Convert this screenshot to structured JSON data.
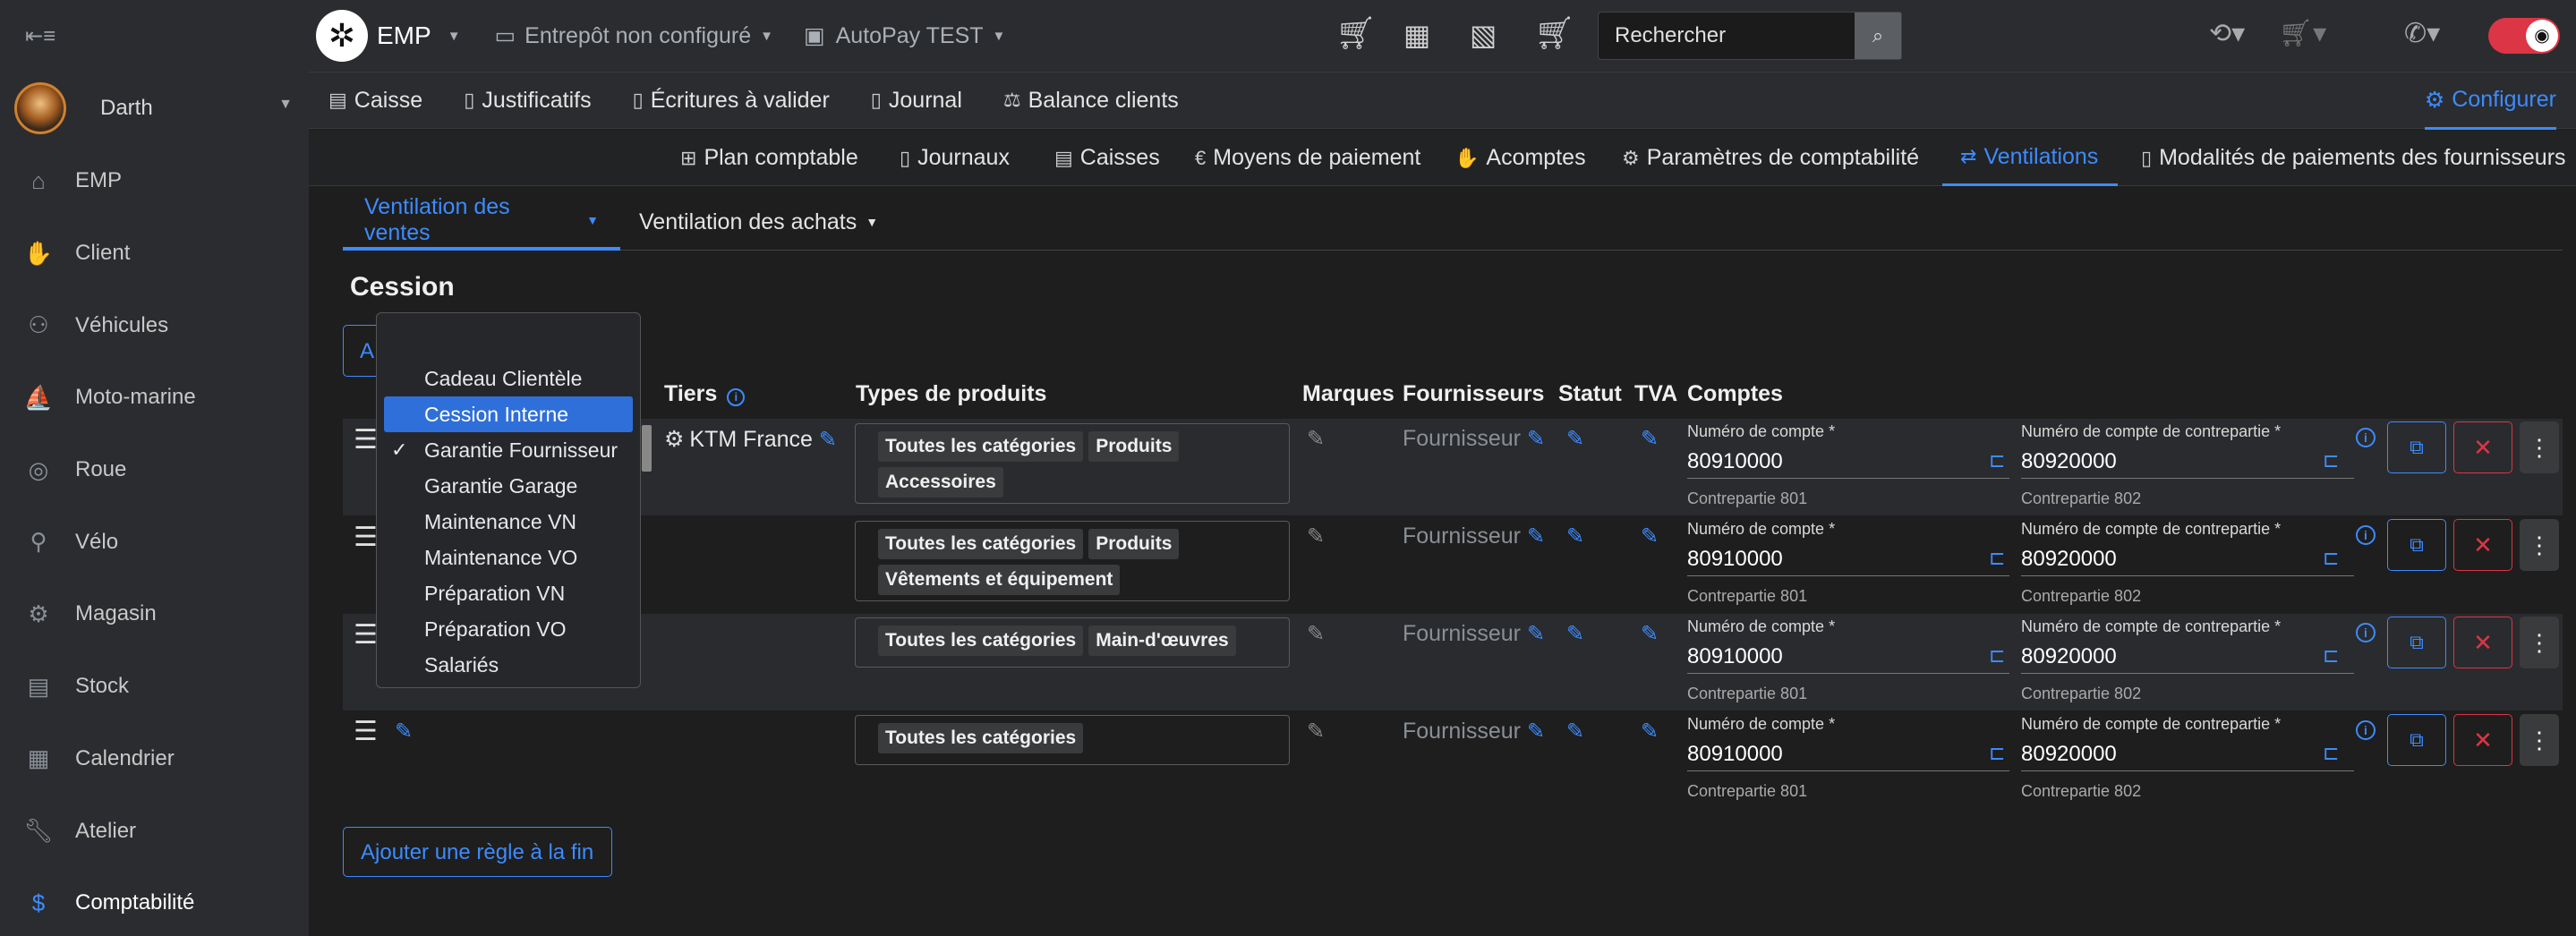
{
  "sidebar": {
    "user": "Darth",
    "items": [
      {
        "label": "EMP",
        "icon": "house-icon"
      },
      {
        "label": "Client",
        "icon": "handshake-icon"
      },
      {
        "label": "Véhicules",
        "icon": "motorcycle-icon"
      },
      {
        "label": "Moto-marine",
        "icon": "jetski-icon"
      },
      {
        "label": "Roue",
        "icon": "wheel-icon"
      },
      {
        "label": "Vélo",
        "icon": "bicycle-icon"
      },
      {
        "label": "Magasin",
        "icon": "store-icon"
      },
      {
        "label": "Stock",
        "icon": "warehouse-icon"
      },
      {
        "label": "Calendrier",
        "icon": "calendar-icon"
      },
      {
        "label": "Atelier",
        "icon": "wrench-icon"
      },
      {
        "label": "Comptabilité",
        "icon": "dollar-icon"
      }
    ]
  },
  "topbar": {
    "brand": "EMP",
    "warehouse": "Entrepôt non configuré",
    "payment": "AutoPay TEST",
    "search_text": "Rechercher"
  },
  "nav1": {
    "items": [
      "Caisse",
      "Justificatifs",
      "Écritures à valider",
      "Journal",
      "Balance clients"
    ],
    "configure": "Configurer"
  },
  "nav2": {
    "items": [
      "Plan comptable",
      "Journaux",
      "Caisses",
      "Moyens de paiement",
      "Acomptes",
      "Paramètres de comptabilité",
      "Ventilations",
      "Modalités de paiements des fournisseurs"
    ]
  },
  "tabs": {
    "sales": "Ventilation des ventes",
    "purchases": "Ventilation des achats"
  },
  "section": {
    "title": "Cession",
    "add_top_partial": "A"
  },
  "table": {
    "headers": {
      "tiers": "Tiers",
      "types": "Types de produits",
      "marques": "Marques",
      "fournisseurs": "Fournisseurs",
      "statut": "Statut",
      "tva": "TVA",
      "comptes": "Comptes"
    },
    "rows": [
      {
        "tiers": "KTM France",
        "tags": [
          "Toutes les catégories",
          "Produits",
          "Accessoires"
        ],
        "fournisseur": "Fournisseur",
        "acc_label": "Numéro de compte *",
        "acc": "80910000",
        "acc_sub": "Contrepartie 801",
        "contra_label": "Numéro de compte de contrepartie *",
        "contra": "80920000",
        "contra_sub": "Contrepartie 802"
      },
      {
        "tiers": "",
        "tags": [
          "Toutes les catégories",
          "Produits",
          "Vêtements et équipement"
        ],
        "fournisseur": "Fournisseur",
        "acc_label": "Numéro de compte *",
        "acc": "80910000",
        "acc_sub": "Contrepartie 801",
        "contra_label": "Numéro de compte de contrepartie *",
        "contra": "80920000",
        "contra_sub": "Contrepartie 802"
      },
      {
        "tiers": "",
        "tags": [
          "Toutes les catégories",
          "Main-d'œuvres"
        ],
        "fournisseur": "Fournisseur",
        "acc_label": "Numéro de compte *",
        "acc": "80910000",
        "acc_sub": "Contrepartie 801",
        "contra_label": "Numéro de compte de contrepartie *",
        "contra": "80920000",
        "contra_sub": "Contrepartie 802"
      },
      {
        "tiers": "",
        "tags": [
          "Toutes les catégories"
        ],
        "fournisseur": "Fournisseur",
        "acc_label": "Numéro de compte *",
        "acc": "80910000",
        "acc_sub": "Contrepartie 801",
        "contra_label": "Numéro de compte de contrepartie *",
        "contra": "80920000",
        "contra_sub": "Contrepartie 802"
      }
    ]
  },
  "dropdown": {
    "options": [
      "Cadeau Clientèle",
      "Cession Interne",
      "Garantie Fournisseur",
      "Garantie Garage",
      "Maintenance VN",
      "Maintenance VO",
      "Préparation VN",
      "Préparation VO",
      "Salariés"
    ],
    "highlighted": "Cession Interne",
    "checked": "Garantie Fournisseur"
  },
  "add_rule_end": "Ajouter une règle à la fin",
  "colors": {
    "accent": "#3d8bfd",
    "danger": "#dc3545",
    "background": "#1e1e1e",
    "sidebar": "#2b2c2f"
  }
}
